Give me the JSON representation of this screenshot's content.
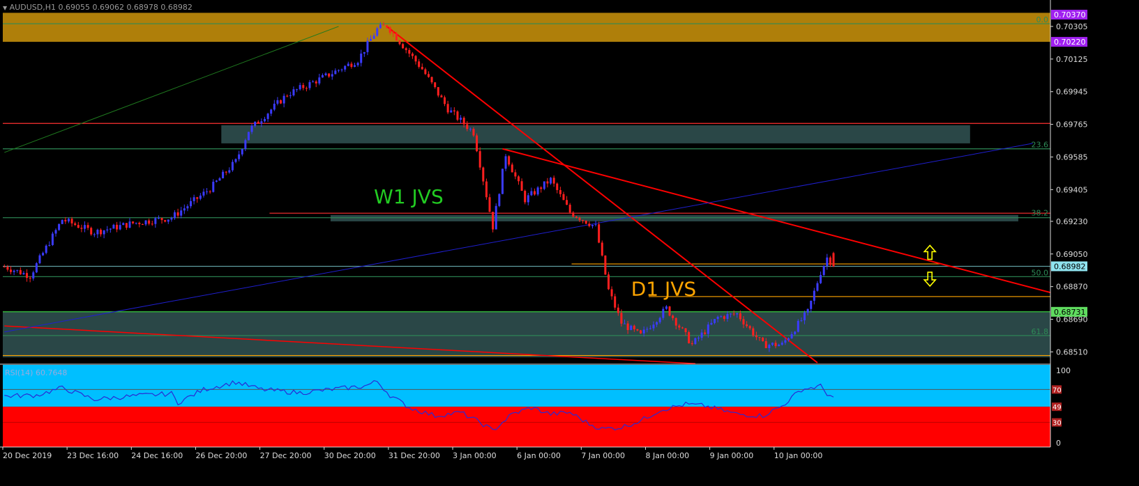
{
  "header": {
    "title": "AUDUSD,H1 0.69055 0.69062 0.68978 0.68982"
  },
  "colors": {
    "bg": "#000000",
    "bull": "#3b3bff",
    "bear": "#ff1f1f",
    "zone": "#2f4f4f",
    "topzone": "#b8860b",
    "trend": "#ff0000",
    "fib": "#2e8b57",
    "level": "#ffa500",
    "blue": "#1f1fd0",
    "green": "#1f7a1f",
    "support": "#32cd32",
    "rsi_upper": "#00bfff",
    "rsi_lower": "#ff0000",
    "rsi_line": "#2a2ad4",
    "bid_tag": "#8fe3ef",
    "support_tag": "#5fdc5f",
    "zone_tag": "#a020f0"
  },
  "chart_data": {
    "type": "candlestick",
    "symbol": "AUDUSD",
    "timeframe": "H1",
    "ohlc_last": {
      "open": 0.69055,
      "high": 0.69062,
      "low": 0.68978,
      "close": 0.68982
    },
    "ylim": [
      0.6845,
      0.7042
    ],
    "price_ticks": [
      "0.70305",
      "0.70125",
      "0.69945",
      "0.69765",
      "0.69585",
      "0.69405",
      "0.69230",
      "0.69050",
      "0.68870",
      "0.68690",
      "0.68510"
    ],
    "price_tick_values": [
      0.70305,
      0.70125,
      0.69945,
      0.69765,
      0.69585,
      0.69405,
      0.6923,
      0.6905,
      0.6887,
      0.6869,
      0.6851
    ],
    "x_labels": [
      "20 Dec 2019",
      "23 Dec 16:00",
      "24 Dec 16:00",
      "26 Dec 20:00",
      "27 Dec 20:00",
      "30 Dec 20:00",
      "31 Dec 20:00",
      "3 Jan 00:00",
      "6 Jan 00:00",
      "7 Jan 00:00",
      "8 Jan 00:00",
      "9 Jan 00:00",
      "10 Jan 00:00"
    ],
    "x_label_bars": [
      0,
      20,
      40,
      60,
      80,
      100,
      120,
      140,
      160,
      180,
      200,
      220,
      240
    ],
    "bars_total": 326,
    "tags": [
      {
        "text": "0.70370",
        "value": 0.7037,
        "style": "zone"
      },
      {
        "text": "0.70220",
        "value": 0.7022,
        "style": "zone"
      },
      {
        "text": "0.68982",
        "value": 0.68982,
        "style": "bid"
      },
      {
        "text": "0.68731",
        "value": 0.68731,
        "style": "support"
      }
    ],
    "fib_labels": [
      {
        "text": "0.0",
        "value": 0.7032
      },
      {
        "text": "23.6",
        "value": 0.6963
      },
      {
        "text": "38.2",
        "value": 0.69255
      },
      {
        "text": "50.0",
        "value": 0.68925
      },
      {
        "text": "61.8",
        "value": 0.686
      }
    ],
    "annotations": [
      {
        "text": "W1 JVS",
        "bar": 115,
        "value": 0.6933,
        "color": "#22cc22"
      },
      {
        "text": "D1 JVS",
        "bar": 195,
        "value": 0.6882,
        "color": "#ffa500"
      }
    ],
    "zones": [
      {
        "bar_from": 0,
        "bar_to": 326,
        "y_top": 0.7038,
        "y_bottom": 0.7022,
        "kind": "top"
      },
      {
        "bar_from": 68,
        "bar_to": 301,
        "y_top": 0.6976,
        "y_bottom": 0.6966,
        "kind": "zone"
      },
      {
        "bar_from": 102,
        "bar_to": 316,
        "y_top": 0.69265,
        "y_bottom": 0.6923,
        "kind": "zone"
      },
      {
        "bar_from": 0,
        "bar_to": 326,
        "y_top": 0.68735,
        "y_bottom": 0.6848,
        "kind": "zone"
      }
    ],
    "anchor_points": [
      {
        "bar": 0,
        "price": 0.6898
      },
      {
        "bar": 8,
        "price": 0.6893
      },
      {
        "bar": 18,
        "price": 0.6924
      },
      {
        "bar": 28,
        "price": 0.6917
      },
      {
        "bar": 40,
        "price": 0.6922
      },
      {
        "bar": 52,
        "price": 0.6925
      },
      {
        "bar": 64,
        "price": 0.6941
      },
      {
        "bar": 72,
        "price": 0.6956
      },
      {
        "bar": 76,
        "price": 0.6973
      },
      {
        "bar": 88,
        "price": 0.6993
      },
      {
        "bar": 100,
        "price": 0.7003
      },
      {
        "bar": 110,
        "price": 0.7012
      },
      {
        "bar": 116,
        "price": 0.7029
      },
      {
        "bar": 119,
        "price": 0.7031
      },
      {
        "bar": 124,
        "price": 0.702
      },
      {
        "bar": 130,
        "price": 0.7007
      },
      {
        "bar": 138,
        "price": 0.6985
      },
      {
        "bar": 146,
        "price": 0.6972
      },
      {
        "bar": 152,
        "price": 0.692
      },
      {
        "bar": 156,
        "price": 0.696
      },
      {
        "bar": 162,
        "price": 0.6935
      },
      {
        "bar": 170,
        "price": 0.6946
      },
      {
        "bar": 176,
        "price": 0.6928
      },
      {
        "bar": 184,
        "price": 0.692
      },
      {
        "bar": 188,
        "price": 0.6885
      },
      {
        "bar": 192,
        "price": 0.6867
      },
      {
        "bar": 198,
        "price": 0.686
      },
      {
        "bar": 206,
        "price": 0.6875
      },
      {
        "bar": 214,
        "price": 0.6855
      },
      {
        "bar": 222,
        "price": 0.687
      },
      {
        "bar": 228,
        "price": 0.6872
      },
      {
        "bar": 236,
        "price": 0.6855
      },
      {
        "bar": 242,
        "price": 0.6855
      },
      {
        "bar": 250,
        "price": 0.6873
      },
      {
        "bar": 254,
        "price": 0.6895
      },
      {
        "bar": 256,
        "price": 0.6903
      },
      {
        "bar": 258,
        "price": 0.6899
      }
    ],
    "trendlines": [
      {
        "from": [
          119,
          0.70305
        ],
        "to": [
          253,
          0.6845
        ],
        "color": "#ff0000",
        "width": 2
      },
      {
        "from": [
          155,
          0.6963
        ],
        "to": [
          326,
          0.68835
        ],
        "color": "#ff0000",
        "width": 2
      },
      {
        "from": [
          0,
          0.68653
        ],
        "to": [
          215,
          0.68445
        ],
        "color": "#ff0000",
        "width": 1.5
      },
      {
        "from": [
          0,
          0.6862
        ],
        "to": [
          320,
          0.6966
        ],
        "color": "#1f1fd0",
        "width": 1
      },
      {
        "from": [
          0,
          0.6961
        ],
        "to": [
          104,
          0.70305
        ],
        "color": "#1f7a1f",
        "width": 1
      }
    ],
    "hlines": [
      {
        "value": 0.6977,
        "color": "#ff3030",
        "bar_from": 0,
        "bar_to": 326
      },
      {
        "value": 0.6963,
        "color": "#2e8b57",
        "bar_from": 0,
        "bar_to": 326
      },
      {
        "value": 0.69275,
        "color": "#ff3030",
        "bar_from": 83,
        "bar_to": 326
      },
      {
        "value": 0.6925,
        "color": "#2e8b57",
        "bar_from": 0,
        "bar_to": 326
      },
      {
        "value": 0.68982,
        "color": "#5f9ea0",
        "bar_from": 0,
        "bar_to": 326
      },
      {
        "value": 0.68995,
        "color": "#ffa500",
        "bar_from": 177,
        "bar_to": 292
      },
      {
        "value": 0.68925,
        "color": "#2e8b57",
        "bar_from": 0,
        "bar_to": 326
      },
      {
        "value": 0.68815,
        "color": "#ffa500",
        "bar_from": 201,
        "bar_to": 326
      },
      {
        "value": 0.68731,
        "color": "#32cd32",
        "bar_from": 0,
        "bar_to": 326
      },
      {
        "value": 0.686,
        "color": "#2e8b57",
        "bar_from": 0,
        "bar_to": 326
      },
      {
        "value": 0.6849,
        "color": "#ffa500",
        "bar_from": 0,
        "bar_to": 326
      },
      {
        "value": 0.7032,
        "color": "#2e8b57",
        "bar_from": 0,
        "bar_to": 326
      }
    ],
    "arrows": [
      {
        "dir": "up",
        "bar": 288,
        "value": 0.69055
      },
      {
        "dir": "down",
        "bar": 288,
        "value": 0.68915
      }
    ],
    "rsi": {
      "label": "RSI(14) 60.7648",
      "period": 14,
      "current": 60.7648,
      "levels": [
        70,
        49,
        30
      ],
      "level_labels": [
        "70",
        "49",
        "30"
      ],
      "scale_labels": [
        "100",
        "0"
      ],
      "ylim": [
        0,
        100
      ],
      "anchor_points": [
        {
          "bar": 0,
          "value": 62
        },
        {
          "bar": 10,
          "value": 63
        },
        {
          "bar": 18,
          "value": 72
        },
        {
          "bar": 28,
          "value": 58
        },
        {
          "bar": 40,
          "value": 62
        },
        {
          "bar": 52,
          "value": 65
        },
        {
          "bar": 54,
          "value": 54
        },
        {
          "bar": 62,
          "value": 70
        },
        {
          "bar": 72,
          "value": 79
        },
        {
          "bar": 80,
          "value": 70
        },
        {
          "bar": 92,
          "value": 66
        },
        {
          "bar": 104,
          "value": 71
        },
        {
          "bar": 112,
          "value": 74
        },
        {
          "bar": 116,
          "value": 80
        },
        {
          "bar": 120,
          "value": 63
        },
        {
          "bar": 126,
          "value": 48
        },
        {
          "bar": 134,
          "value": 38
        },
        {
          "bar": 142,
          "value": 42
        },
        {
          "bar": 148,
          "value": 30
        },
        {
          "bar": 152,
          "value": 20
        },
        {
          "bar": 158,
          "value": 40
        },
        {
          "bar": 164,
          "value": 48
        },
        {
          "bar": 170,
          "value": 40
        },
        {
          "bar": 176,
          "value": 42
        },
        {
          "bar": 182,
          "value": 28
        },
        {
          "bar": 186,
          "value": 22
        },
        {
          "bar": 192,
          "value": 24
        },
        {
          "bar": 198,
          "value": 32
        },
        {
          "bar": 204,
          "value": 45
        },
        {
          "bar": 212,
          "value": 52
        },
        {
          "bar": 218,
          "value": 50
        },
        {
          "bar": 228,
          "value": 40
        },
        {
          "bar": 236,
          "value": 38
        },
        {
          "bar": 242,
          "value": 50
        },
        {
          "bar": 248,
          "value": 70
        },
        {
          "bar": 254,
          "value": 74
        },
        {
          "bar": 256,
          "value": 65
        },
        {
          "bar": 258,
          "value": 60.8
        }
      ]
    }
  }
}
